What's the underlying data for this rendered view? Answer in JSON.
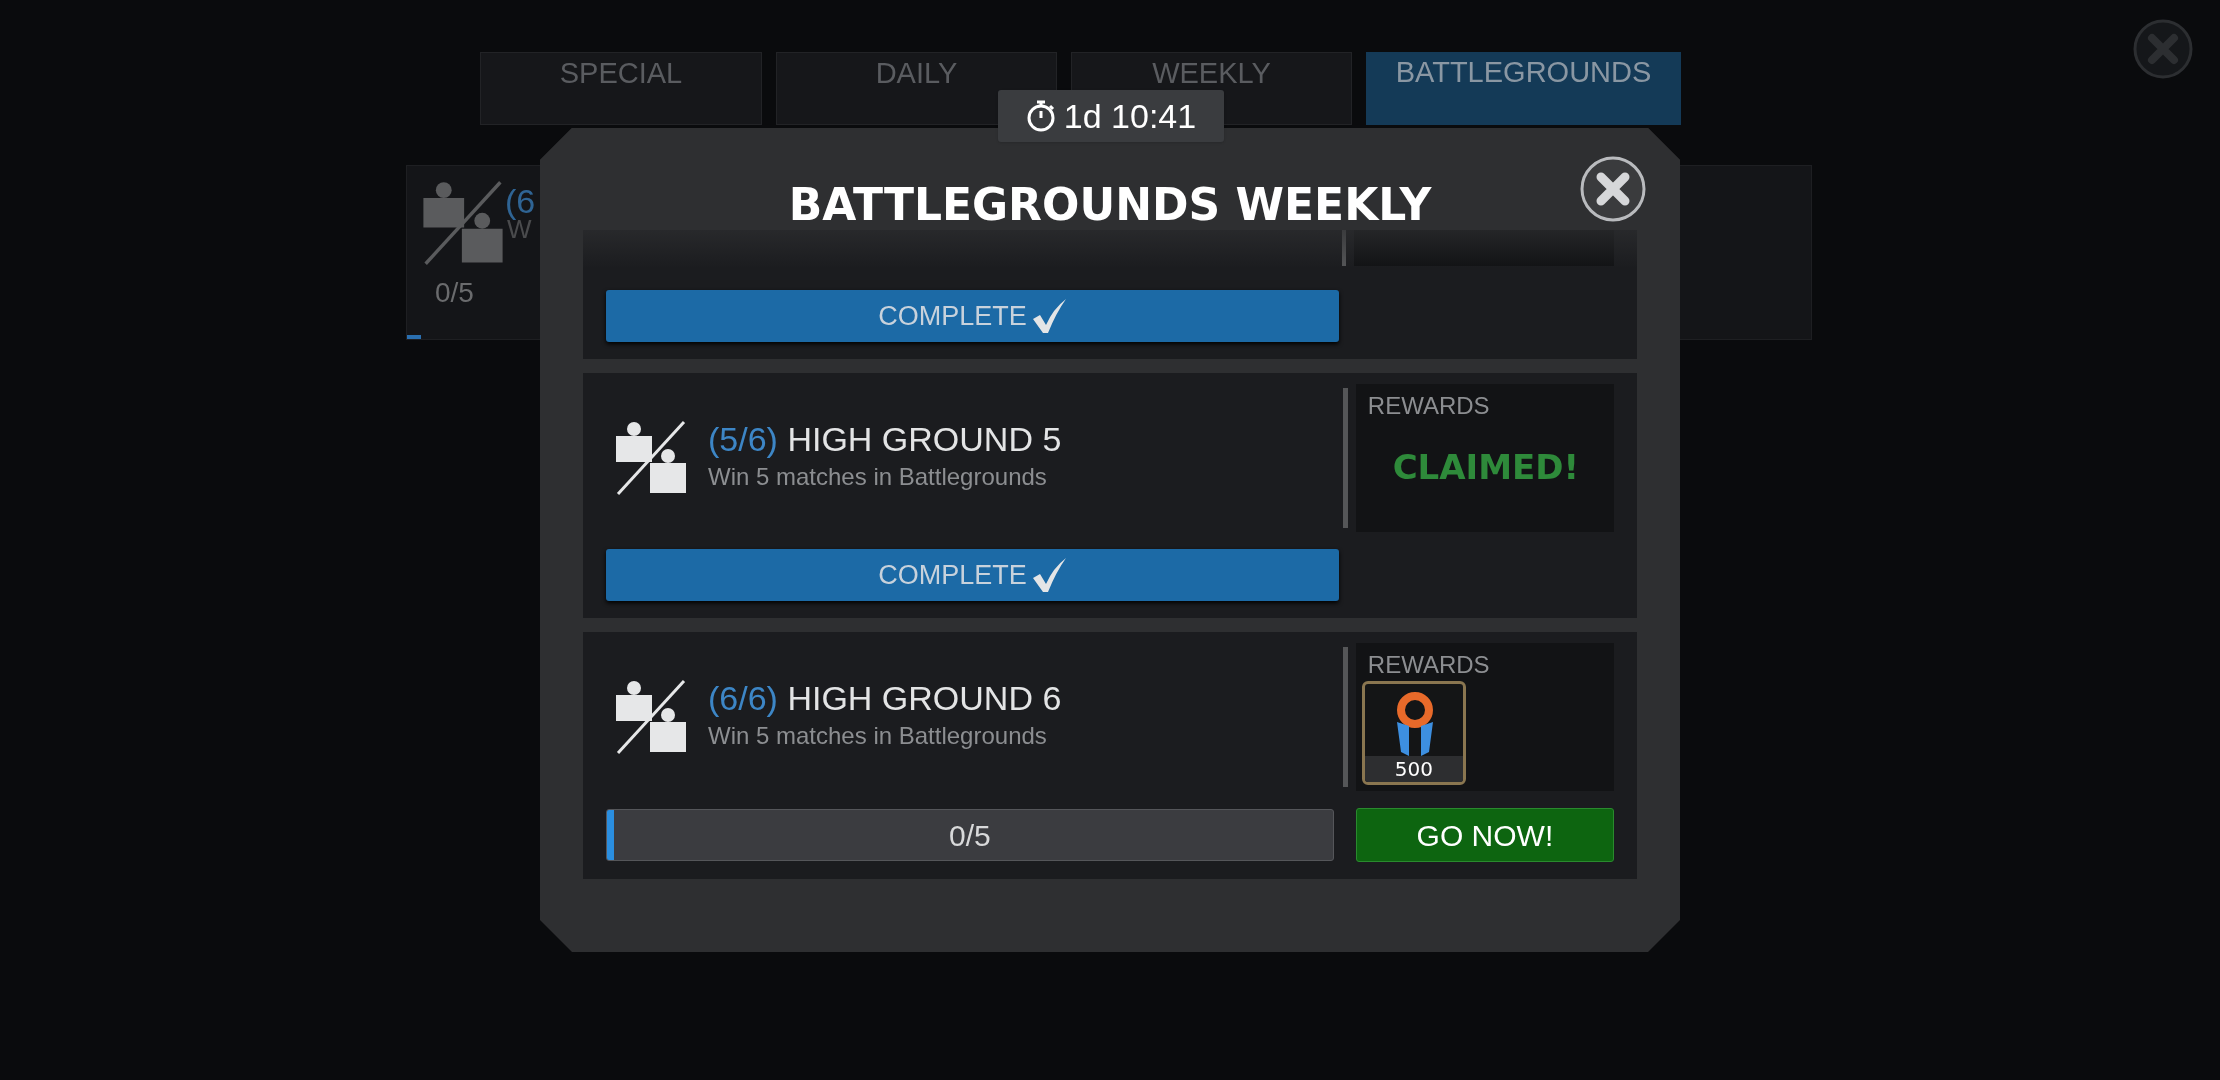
{
  "tabs": [
    {
      "label": "SPECIAL",
      "selected": false
    },
    {
      "label": "DAILY",
      "selected": false
    },
    {
      "label": "WEEKLY",
      "selected": false
    },
    {
      "label": "BATTLEGROUNDS",
      "selected": true
    }
  ],
  "background_card": {
    "progress": "(6",
    "title": "W",
    "count": "0/5",
    "level": 0.01
  },
  "timer": "1d 10:41",
  "modal": {
    "title": "BATTLEGROUNDS WEEKLY",
    "quests": [
      {
        "kind": "partial",
        "action": {
          "kind": "complete",
          "label": "COMPLETE"
        }
      },
      {
        "kind": "full",
        "progress": "(5/6)",
        "title": "HIGH GROUND 5",
        "description": "Win 5 matches in Battlegrounds",
        "rewards_label": "REWARDS",
        "reward": {
          "kind": "claimed",
          "text": "CLAIMED!"
        },
        "action": {
          "kind": "complete",
          "label": "COMPLETE"
        }
      },
      {
        "kind": "full",
        "progress": "(6/6)",
        "title": "HIGH GROUND 6",
        "description": "Win 5 matches in Battlegrounds",
        "rewards_label": "REWARDS",
        "reward": {
          "kind": "item",
          "amount": "500"
        },
        "action": {
          "kind": "progress",
          "count": "0/5",
          "level": 0.01,
          "button": "GO NOW!"
        }
      }
    ]
  }
}
